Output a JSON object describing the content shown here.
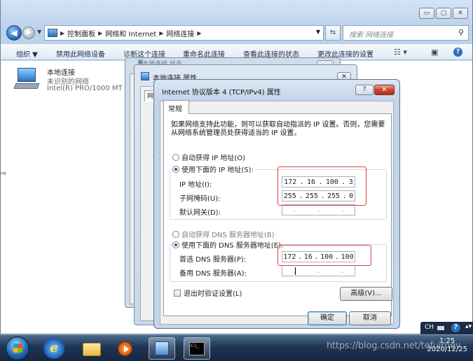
{
  "window": {
    "minimize": "▭",
    "maximize": "▢",
    "close": "✕"
  },
  "address": {
    "crumbs": [
      "控制面板",
      "网络和 Internet",
      "网络连接"
    ],
    "search_placeholder": "搜索 网络连接"
  },
  "toolbar": {
    "organize": "组织 ▼",
    "disable_device": "禁用此网络设备",
    "diagnose": "诊断这个连接",
    "rename": "重命名此连接",
    "view_status": "查看此连接的状态",
    "change_settings": "更改此连接的设置"
  },
  "connection": {
    "name": "本地连接",
    "status": "未识别的网络",
    "device": "Intel(R) PRO/1000 MT I"
  },
  "bg_dialog_top": {
    "title": "本地连接 状态"
  },
  "bg_dialog_props": {
    "title": "本地连接 属性",
    "tab_stub": "网",
    "close": "✕",
    "letters": [
      "连",
      "此"
    ]
  },
  "dialog": {
    "title": "Internet 协议版本 4 (TCP/IPv4) 属性",
    "help": "?",
    "close": "✕",
    "tab": "常规",
    "description": "如果网络支持此功能，则可以获取自动指派的 IP 设置。否则，您需要从网络系统管理员处获得适当的 IP 设置。",
    "ip_auto": "自动获得 IP 地址(O)",
    "ip_manual": "使用下面的 IP 地址(S):",
    "ip_label": "IP 地址(I):",
    "mask_label": "子网掩码(U):",
    "gateway_label": "默认网关(D):",
    "ip_octets": [
      "172",
      "16",
      "100",
      "3"
    ],
    "mask_octets": [
      "255",
      "255",
      "255",
      "0"
    ],
    "gateway_octets": [
      ".",
      ".",
      "."
    ],
    "dns_auto": "自动获得 DNS 服务器地址(B)",
    "dns_manual": "使用下面的 DNS 服务器地址(E):",
    "dns1_label": "首选 DNS 服务器(P):",
    "dns2_label": "备用 DNS 服务器(A):",
    "dns1_octets": [
      "172",
      "16",
      "100",
      "100"
    ],
    "dns2_octets": [
      ".",
      ".",
      "."
    ],
    "validate": "退出时验证设置(L)",
    "advanced": "高级(V)...",
    "ok": "确定",
    "cancel": "取消"
  },
  "tray": {
    "lang": "CH",
    "help": "?",
    "more": "▴▾",
    "time": "1:25",
    "date": "2020/12/25"
  },
  "watermark": "https://blog.csdn.net/tefuirnev"
}
